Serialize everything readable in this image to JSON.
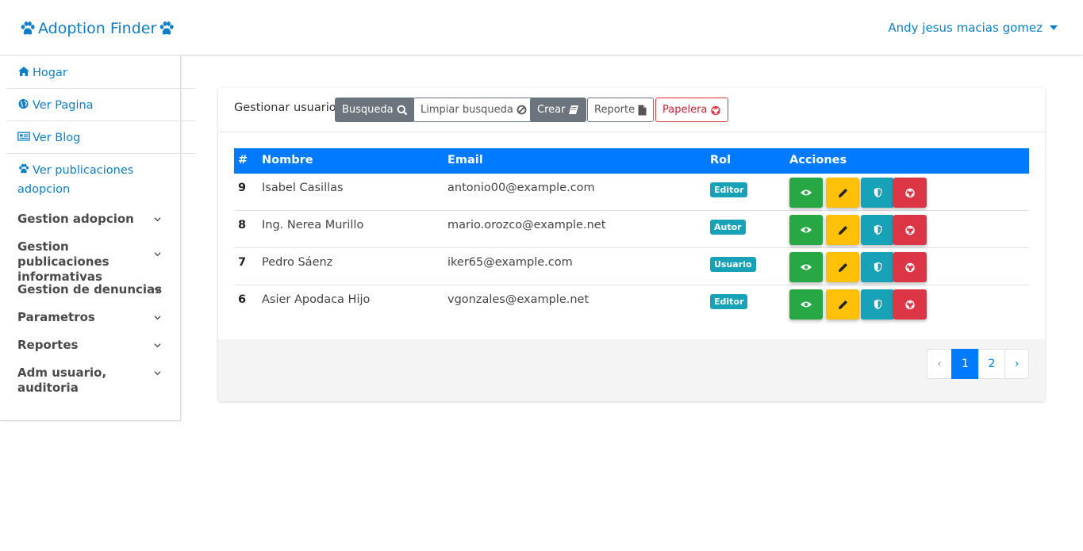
{
  "navbar": {
    "brand": "Adoption Finder",
    "user_name": "Andy jesus macias gomez"
  },
  "sidebar": {
    "links": [
      {
        "label": "Hogar",
        "icon": "home-icon"
      },
      {
        "label": "Ver Pagina",
        "icon": "globe-icon"
      },
      {
        "label": "Ver Blog",
        "icon": "newspaper-icon"
      },
      {
        "label": "Ver publicaciones adopcion",
        "icon": "paw-icon"
      }
    ],
    "groups": [
      {
        "label": "Gestion adopcion"
      },
      {
        "label": "Gestion publicaciones informativas"
      },
      {
        "label": "Gestion de denuncias"
      },
      {
        "label": "Parametros"
      },
      {
        "label": "Reportes"
      },
      {
        "label": "Adm usuario, auditoria"
      }
    ]
  },
  "card": {
    "title": "Gestionar usuario",
    "buttons": {
      "search": "Busqueda",
      "clear": "Limpiar busqueda",
      "create": "Crear",
      "report": "Reporte",
      "trash": "Papelera"
    }
  },
  "table": {
    "headers": [
      "#",
      "Nombre",
      "Email",
      "Rol",
      "Acciones"
    ],
    "rows": [
      {
        "id": "9",
        "name": "Isabel Casillas",
        "email": "antonio00@example.com",
        "role": "Editor"
      },
      {
        "id": "8",
        "name": "Ing. Nerea Murillo",
        "email": "mario.orozco@example.net",
        "role": "Autor"
      },
      {
        "id": "7",
        "name": "Pedro Sáenz",
        "email": "iker65@example.com",
        "role": "Usuario"
      },
      {
        "id": "6",
        "name": "Asier Apodaca Hijo",
        "email": "vgonzales@example.net",
        "role": "Editor"
      }
    ]
  },
  "pagination": {
    "prev": "‹",
    "pages": [
      "1",
      "2"
    ],
    "current": "1",
    "next": "›"
  },
  "colors": {
    "primary": "#007bff",
    "link": "#0d7ec8",
    "success": "#28a745",
    "warning": "#ffc107",
    "info": "#17a2b8",
    "danger": "#dc3545",
    "secondary": "#6c757d"
  }
}
